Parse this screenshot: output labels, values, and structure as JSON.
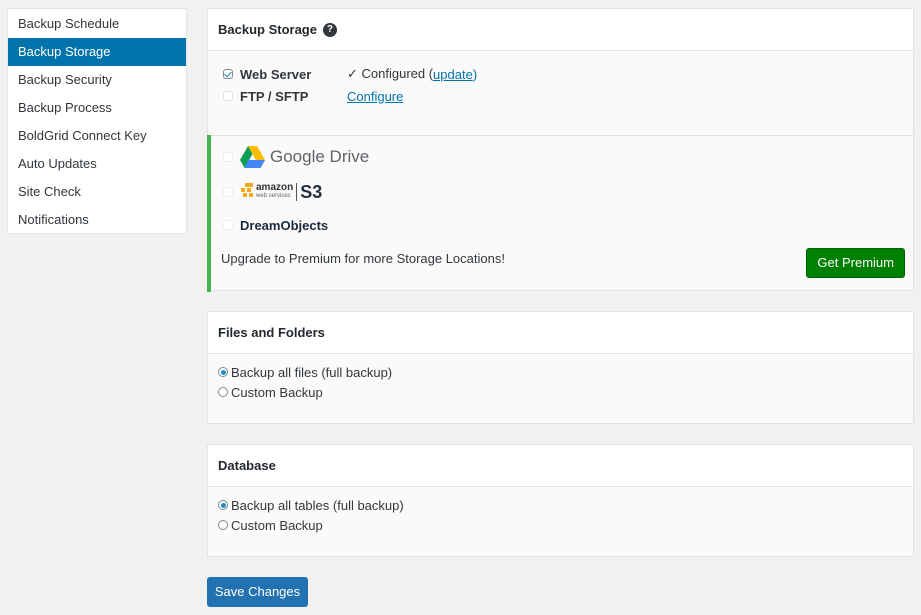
{
  "sidebar": {
    "items": [
      {
        "label": "Backup Schedule",
        "active": false
      },
      {
        "label": "Backup Storage",
        "active": true
      },
      {
        "label": "Backup Security",
        "active": false
      },
      {
        "label": "Backup Process",
        "active": false
      },
      {
        "label": "BoldGrid Connect Key",
        "active": false
      },
      {
        "label": "Auto Updates",
        "active": false
      },
      {
        "label": "Site Check",
        "active": false
      },
      {
        "label": "Notifications",
        "active": false
      }
    ]
  },
  "storage": {
    "title": "Backup Storage",
    "help_icon": "question-circle-icon",
    "web_server": {
      "label": "Web Server",
      "checked": true,
      "status": "✓ Configured (",
      "link": "update",
      "status_end": ")"
    },
    "ftp": {
      "label": "FTP / SFTP",
      "checked": false,
      "link": "Configure"
    },
    "premium": {
      "google_drive": "Google Drive",
      "amazon": "amazon",
      "amazon_sub": "web services",
      "s3": "S3",
      "dreamobjects": "DreamObjects",
      "upgrade_text": "Upgrade to Premium for more Storage Locations!",
      "button": "Get Premium"
    }
  },
  "files": {
    "title": "Files and Folders",
    "options": [
      {
        "label": "Backup all files (full backup)",
        "selected": true
      },
      {
        "label": "Custom Backup",
        "selected": false
      }
    ]
  },
  "database": {
    "title": "Database",
    "options": [
      {
        "label": "Backup all tables (full backup)",
        "selected": true
      },
      {
        "label": "Custom Backup",
        "selected": false
      }
    ]
  },
  "save_button": "Save Changes",
  "colors": {
    "accent": "#0073aa",
    "premium_green": "#008000",
    "premium_border": "#46b450",
    "save_blue": "#2271b1"
  }
}
